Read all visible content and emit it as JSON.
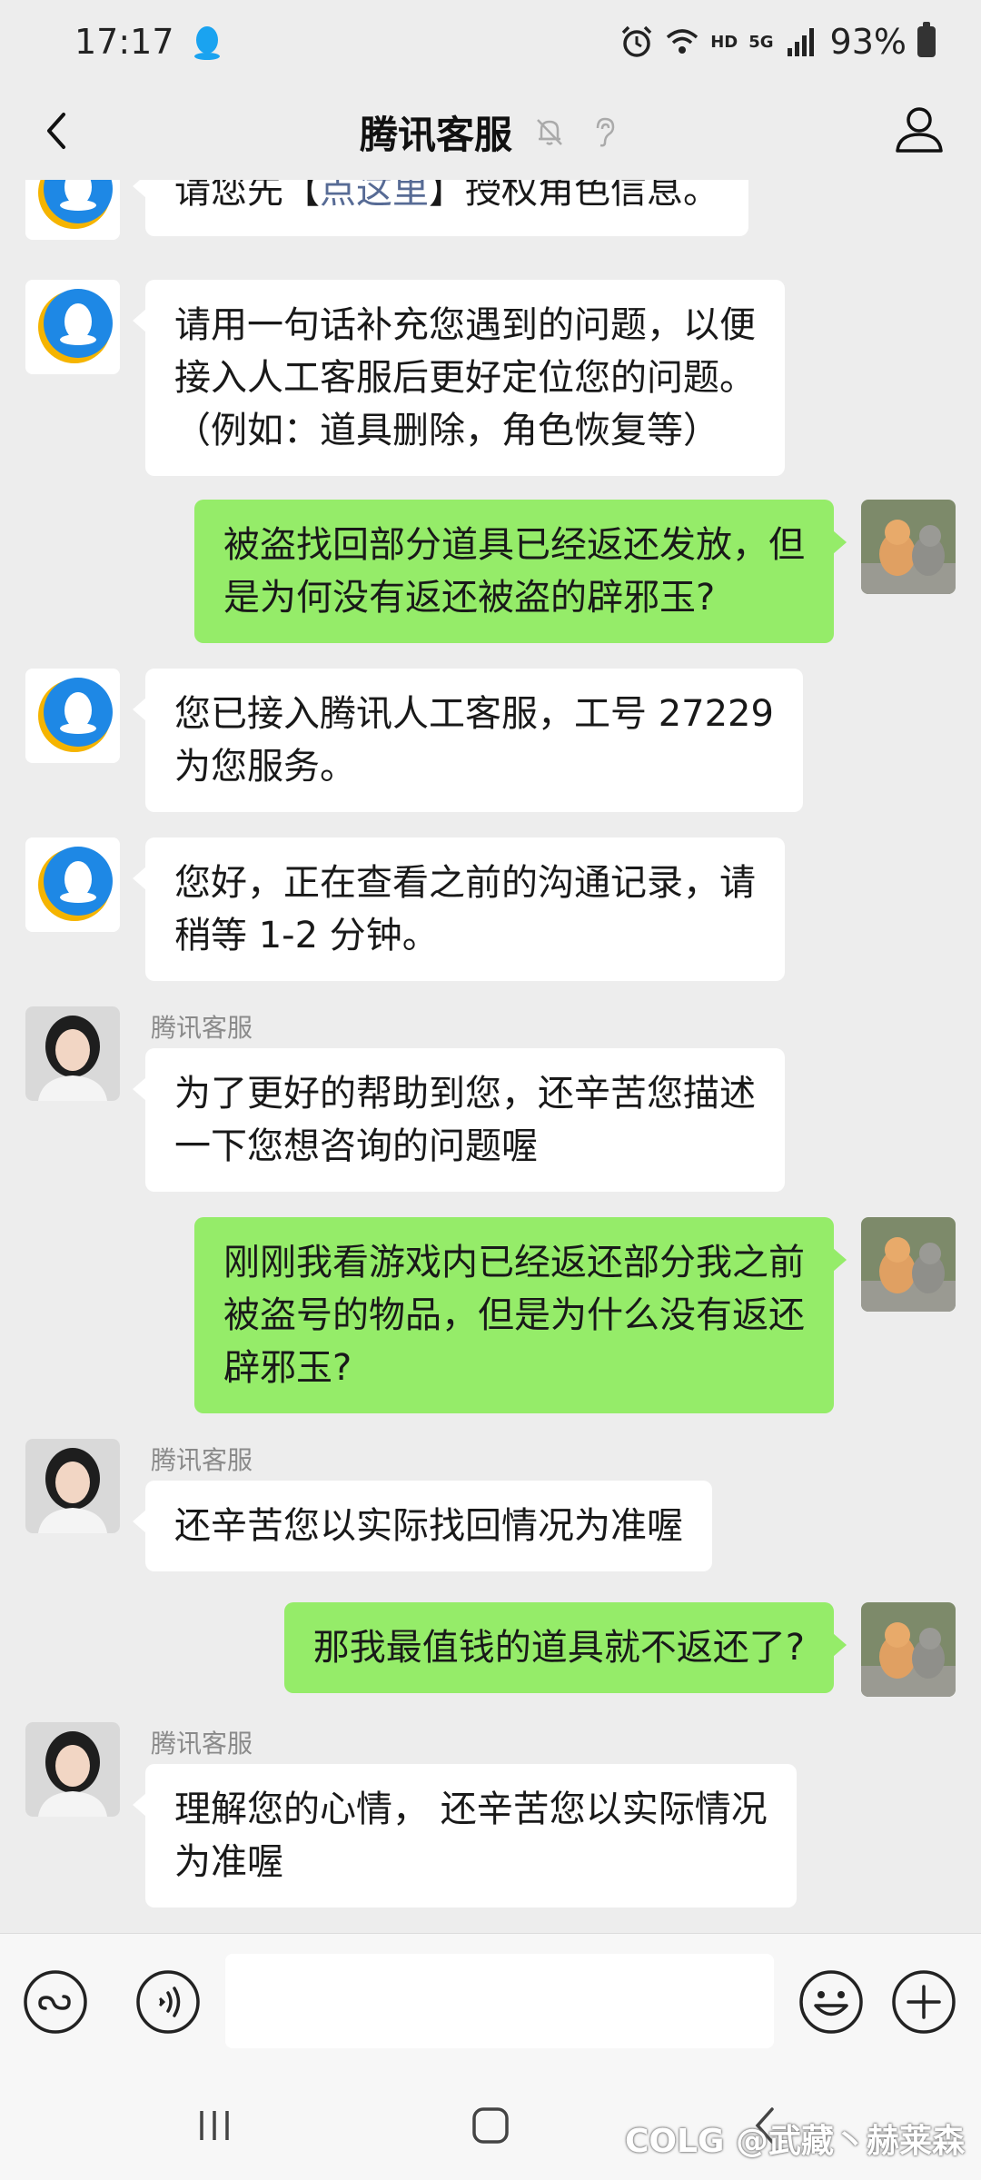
{
  "status_bar": {
    "time": "17:17",
    "network": "HD",
    "signal": "5G",
    "battery": "93%"
  },
  "header": {
    "title": "腾讯客服"
  },
  "messages": [
    {
      "direction": "in",
      "avatar": "qq-logo",
      "sender": "",
      "text_pre": "请您先【",
      "link": "点这里",
      "text_post": "】授权角色信息。"
    },
    {
      "direction": "in",
      "avatar": "qq-logo",
      "sender": "",
      "lines": [
        "请用一句话补充您遇到的问题，以便",
        "接入人工客服后更好定位您的问题。",
        "（例如：道具删除，角色恢复等）"
      ]
    },
    {
      "direction": "out",
      "avatar": "cat-photo",
      "lines": [
        "被盗找回部分道具已经返还发放，但",
        "是为何没有返还被盗的辟邪玉?"
      ]
    },
    {
      "direction": "in",
      "avatar": "qq-logo",
      "sender": "",
      "lines": [
        "您已接入腾讯人工客服，工号 27229",
        "为您服务。"
      ]
    },
    {
      "direction": "in",
      "avatar": "qq-logo",
      "sender": "",
      "lines": [
        "您好，正在查看之前的沟通记录，请",
        "稍等 1-2 分钟。"
      ]
    },
    {
      "direction": "in",
      "avatar": "agent-photo",
      "sender": "腾讯客服",
      "lines": [
        "为了更好的帮助到您，还辛苦您描述",
        "一下您想咨询的问题喔"
      ]
    },
    {
      "direction": "out",
      "avatar": "cat-photo",
      "lines": [
        "刚刚我看游戏内已经返还部分我之前",
        "被盗号的物品，但是为什么没有返还",
        "辟邪玉?"
      ]
    },
    {
      "direction": "in",
      "avatar": "agent-photo",
      "sender": "腾讯客服",
      "lines": [
        "还辛苦您以实际找回情况为准喔"
      ]
    },
    {
      "direction": "out",
      "avatar": "cat-photo",
      "lines": [
        "那我最值钱的道具就不返还了?"
      ]
    },
    {
      "direction": "in",
      "avatar": "agent-photo",
      "sender": "腾讯客服",
      "lines": [
        "理解您的心情， 还辛苦您以实际情况",
        "为准喔"
      ]
    }
  ],
  "input_bar": {
    "value": "",
    "placeholder": ""
  },
  "watermark": "COLG @武藏丶赫莱森",
  "colors": {
    "background": "#ededed",
    "incoming_bubble": "#ffffff",
    "outgoing_bubble": "#95ec69",
    "link": "#576b95"
  }
}
